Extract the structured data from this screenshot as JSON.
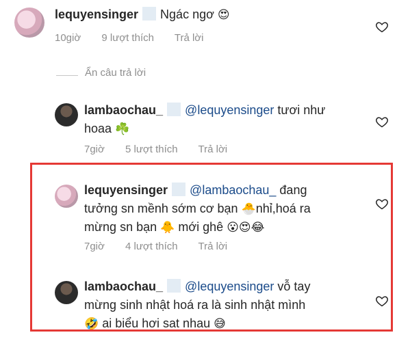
{
  "comment1": {
    "username": "lequyensinger",
    "text": "Ngác ngơ",
    "emoji": "😍",
    "time": "10giờ",
    "likes": "9 lượt thích",
    "reply": "Trả lời"
  },
  "hide_replies_label": "Ẩn câu trả lời",
  "reply1": {
    "username": "lambaochau_",
    "mention": "@lequyensinger",
    "text_a": "tươi như",
    "text_b": "hoaa",
    "emoji": "☘️",
    "time": "7giờ",
    "likes": "5 lượt thích",
    "reply": "Trả lời"
  },
  "reply2": {
    "username": "lequyensinger",
    "mention": "@lambaochau_",
    "text_a": "đang",
    "text_b": "tưởng sn mềnh sớm cơ bạn",
    "emoji_b": "🐣",
    "text_b2": "nhỉ,hoá ra",
    "text_c": "mừng sn bạn",
    "emoji_c": "🐥",
    "text_c2": "mới ghê",
    "emoji_c2": "😮😍😂",
    "time": "7giờ",
    "likes": "4 lượt thích",
    "reply": "Trả lời"
  },
  "reply3": {
    "username": "lambaochau_",
    "mention": "@lequyensinger",
    "text_a": "vỗ tay",
    "text_b": "mừng sinh nhật hoá ra là sinh nhật mình",
    "emoji_c": "🤣",
    "text_c": "ai biểu hơi sat nhau",
    "emoji_c2": "😅"
  }
}
